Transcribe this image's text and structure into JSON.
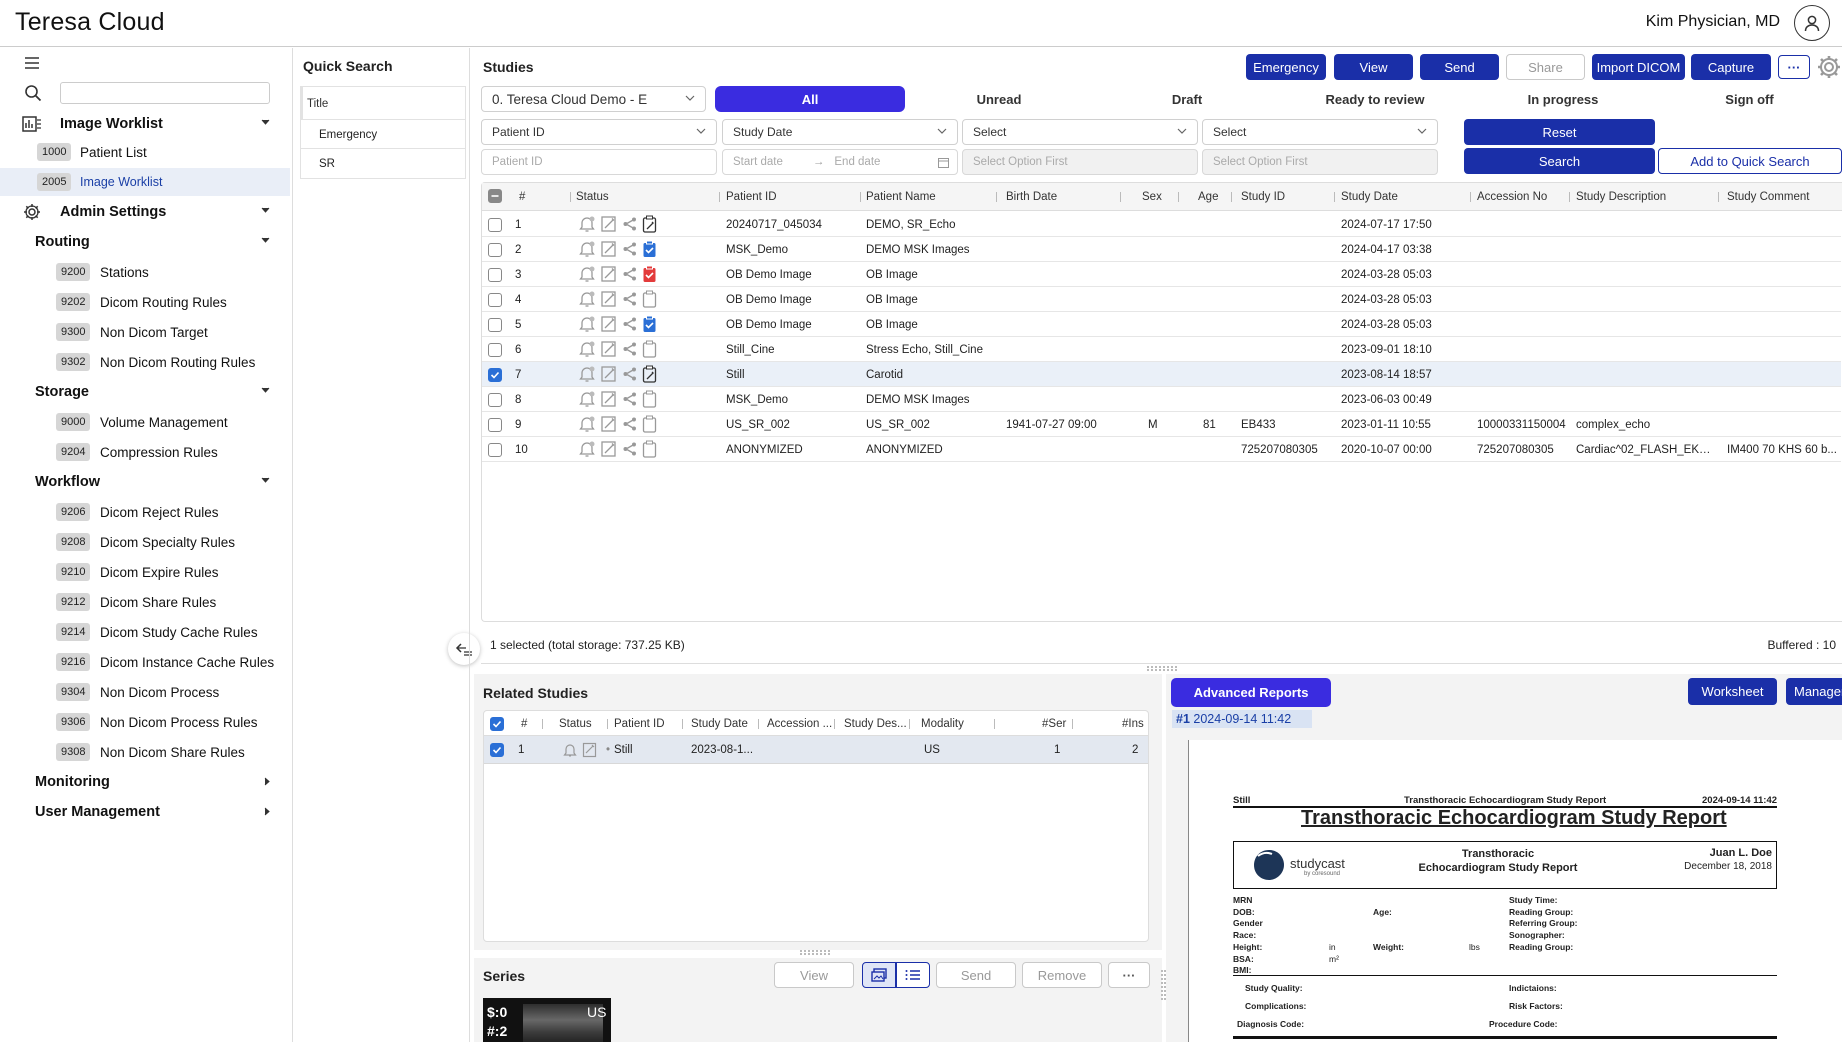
{
  "app": {
    "title": "Teresa Cloud",
    "user": "Kim Physician, MD"
  },
  "sidebar": {
    "search_placeholder": "",
    "sections": {
      "image_worklist": "Image Worklist",
      "admin_settings": "Admin Settings",
      "routing": "Routing",
      "storage": "Storage",
      "workflow": "Workflow",
      "monitoring": "Monitoring",
      "user_management": "User Management"
    },
    "items": [
      {
        "code": "1000",
        "label": "Patient List"
      },
      {
        "code": "2005",
        "label": "Image Worklist"
      },
      {
        "code": "9200",
        "label": "Stations"
      },
      {
        "code": "9202",
        "label": "Dicom Routing Rules"
      },
      {
        "code": "9300",
        "label": "Non Dicom Target"
      },
      {
        "code": "9302",
        "label": "Non Dicom Routing Rules"
      },
      {
        "code": "9000",
        "label": "Volume Management"
      },
      {
        "code": "9204",
        "label": "Compression Rules"
      },
      {
        "code": "9206",
        "label": "Dicom Reject Rules"
      },
      {
        "code": "9208",
        "label": "Dicom Specialty Rules"
      },
      {
        "code": "9210",
        "label": "Dicom Expire Rules"
      },
      {
        "code": "9212",
        "label": "Dicom Share Rules"
      },
      {
        "code": "9214",
        "label": "Dicom Study Cache Rules"
      },
      {
        "code": "9216",
        "label": "Dicom Instance Cache Rules"
      },
      {
        "code": "9304",
        "label": "Non Dicom Process"
      },
      {
        "code": "9306",
        "label": "Non Dicom Process Rules"
      },
      {
        "code": "9308",
        "label": "Non Dicom Share Rules"
      }
    ]
  },
  "quick_search": {
    "title": "Quick Search",
    "column": "Title",
    "items": [
      "Emergency",
      "SR"
    ]
  },
  "studies": {
    "title": "Studies",
    "buttons": {
      "emergency": "Emergency",
      "view": "View",
      "send": "Send",
      "share": "Share",
      "import": "Import DICOM",
      "capture": "Capture",
      "more": "···"
    },
    "source": "0. Teresa Cloud Demo - E",
    "tabs": [
      "All",
      "Unread",
      "Draft",
      "Ready to review",
      "In progress",
      "Sign off"
    ],
    "filters": {
      "f1": "Patient ID",
      "f2": "Study Date",
      "f3": "Select",
      "f4": "Select",
      "p1": "Patient ID",
      "p2a": "Start date",
      "p2arrow": "→",
      "p2b": "End date",
      "p3": "Select Option First",
      "p4": "Select Option First",
      "reset": "Reset",
      "search": "Search",
      "add_quick": "Add to Quick Search"
    },
    "columns": [
      "#",
      "Status",
      "Patient ID",
      "Patient Name",
      "Birth Date",
      "Sex",
      "Age",
      "Study ID",
      "Study Date",
      "Accession No",
      "Study Description",
      "Study Comment"
    ],
    "rows": [
      {
        "n": "1",
        "pid": "20240717_045034",
        "name": "DEMO, SR_Echo",
        "birth": "",
        "sex": "",
        "age": "",
        "sid": "",
        "date": "2024-07-17 17:50",
        "acc": "",
        "desc": "",
        "comment": "",
        "report": "edit",
        "checked": false
      },
      {
        "n": "2",
        "pid": "MSK_Demo",
        "name": "DEMO MSK Images",
        "birth": "",
        "sex": "",
        "age": "",
        "sid": "",
        "date": "2024-04-17 03:38",
        "acc": "",
        "desc": "",
        "comment": "",
        "report": "blue",
        "checked": false
      },
      {
        "n": "3",
        "pid": "OB Demo Image",
        "name": "OB Image",
        "birth": "",
        "sex": "",
        "age": "",
        "sid": "",
        "date": "2024-03-28 05:03",
        "acc": "",
        "desc": "",
        "comment": "",
        "report": "red",
        "checked": false
      },
      {
        "n": "4",
        "pid": "OB Demo Image",
        "name": "OB Image",
        "birth": "",
        "sex": "",
        "age": "",
        "sid": "",
        "date": "2024-03-28 05:03",
        "acc": "",
        "desc": "",
        "comment": "",
        "report": "empty",
        "checked": false
      },
      {
        "n": "5",
        "pid": "OB Demo Image",
        "name": "OB Image",
        "birth": "",
        "sex": "",
        "age": "",
        "sid": "",
        "date": "2024-03-28 05:03",
        "acc": "",
        "desc": "",
        "comment": "",
        "report": "blue",
        "checked": false
      },
      {
        "n": "6",
        "pid": "Still_Cine",
        "name": "Stress Echo, Still_Cine",
        "birth": "",
        "sex": "",
        "age": "",
        "sid": "",
        "date": "2023-09-01 18:10",
        "acc": "",
        "desc": "",
        "comment": "",
        "report": "empty",
        "checked": false
      },
      {
        "n": "7",
        "pid": "Still",
        "name": "Carotid",
        "birth": "",
        "sex": "",
        "age": "",
        "sid": "",
        "date": "2023-08-14 18:57",
        "acc": "",
        "desc": "",
        "comment": "",
        "report": "edit",
        "checked": true
      },
      {
        "n": "8",
        "pid": "MSK_Demo",
        "name": "DEMO MSK Images",
        "birth": "",
        "sex": "",
        "age": "",
        "sid": "",
        "date": "2023-06-03 00:49",
        "acc": "",
        "desc": "",
        "comment": "",
        "report": "empty",
        "checked": false
      },
      {
        "n": "9",
        "pid": "US_SR_002",
        "name": "US_SR_002",
        "birth": "1941-07-27 09:00",
        "sex": "M",
        "age": "81",
        "sid": "EB433",
        "date": "2023-01-11 10:55",
        "acc": "10000331150004",
        "desc": "complex_echo",
        "comment": "",
        "report": "empty",
        "checked": false
      },
      {
        "n": "10",
        "pid": "ANONYMIZED",
        "name": "ANONYMIZED",
        "birth": "",
        "sex": "",
        "age": "",
        "sid": "725207080305",
        "date": "2020-10-07 00:00",
        "acc": "725207080305",
        "desc": "Cardiac^02_FLASH_EKG...",
        "comment": "IM400 70 KHS 60 b...",
        "report": "empty",
        "checked": false
      }
    ],
    "footer_selected": "1 selected (total storage: 737.25 KB)",
    "footer_buffered": "Buffered : 10"
  },
  "related": {
    "title": "Related Studies",
    "columns": [
      "#",
      "Status",
      "Patient ID",
      "Study Date",
      "Accession ...",
      "Study Des...",
      "Modality",
      "#Ser",
      "#Ins"
    ],
    "row": {
      "n": "1",
      "pid": "Still",
      "date": "2023-08-1...",
      "modality": "US",
      "ser": "1",
      "ins": "2"
    }
  },
  "series": {
    "title": "Series",
    "buttons": {
      "view": "View",
      "send": "Send",
      "remove": "Remove",
      "more": "···"
    },
    "thumb": {
      "s": "$:0",
      "n": "#:2",
      "mod": "US"
    }
  },
  "reports": {
    "advanced": "Advanced Reports",
    "worksheet": "Worksheet",
    "manager": "Manager",
    "entry": "2024-09-14 11:42",
    "entry_prefix": "#1",
    "doc": {
      "patient": "Still",
      "header_title": "Transthoracic Echocardiogram Study Report",
      "header_date": "2024-09-14 11:42",
      "big_title": "Transthoracic Echocardiogram Study Report",
      "logo": "studycast",
      "logo_sub": "by coresound",
      "box_title": "Transthoracic Echocardiogram Study Report",
      "doctor": "Juan L. Doe",
      "doctor_date": "December 18, 2018",
      "left_labels": [
        "MRN",
        "DOB:",
        "Gender",
        "Race:",
        "Height:",
        "BSA:",
        "BMI:"
      ],
      "height_unit": "in",
      "bsa_unit": "m²",
      "age": "Age:",
      "weight": "Weight:",
      "weight_unit": "lbs",
      "right_labels": [
        "Study Time:",
        "Reading Group:",
        "Referring Group:",
        "Sonographer:",
        "Reading Group:"
      ],
      "quality": "Study Quality:",
      "indications": "Indictaions:",
      "complications": "Complications:",
      "risk": "Risk Factors:",
      "diagnosis": "Diagnosis Code:",
      "procedure": "Procedure Code:"
    }
  },
  "colors": {
    "primary": "#1a2fa8",
    "active_tab": "#3a2ce0",
    "advanced": "#3a2ce0",
    "check": "#2a6fd6",
    "red": "#e33b3b"
  }
}
